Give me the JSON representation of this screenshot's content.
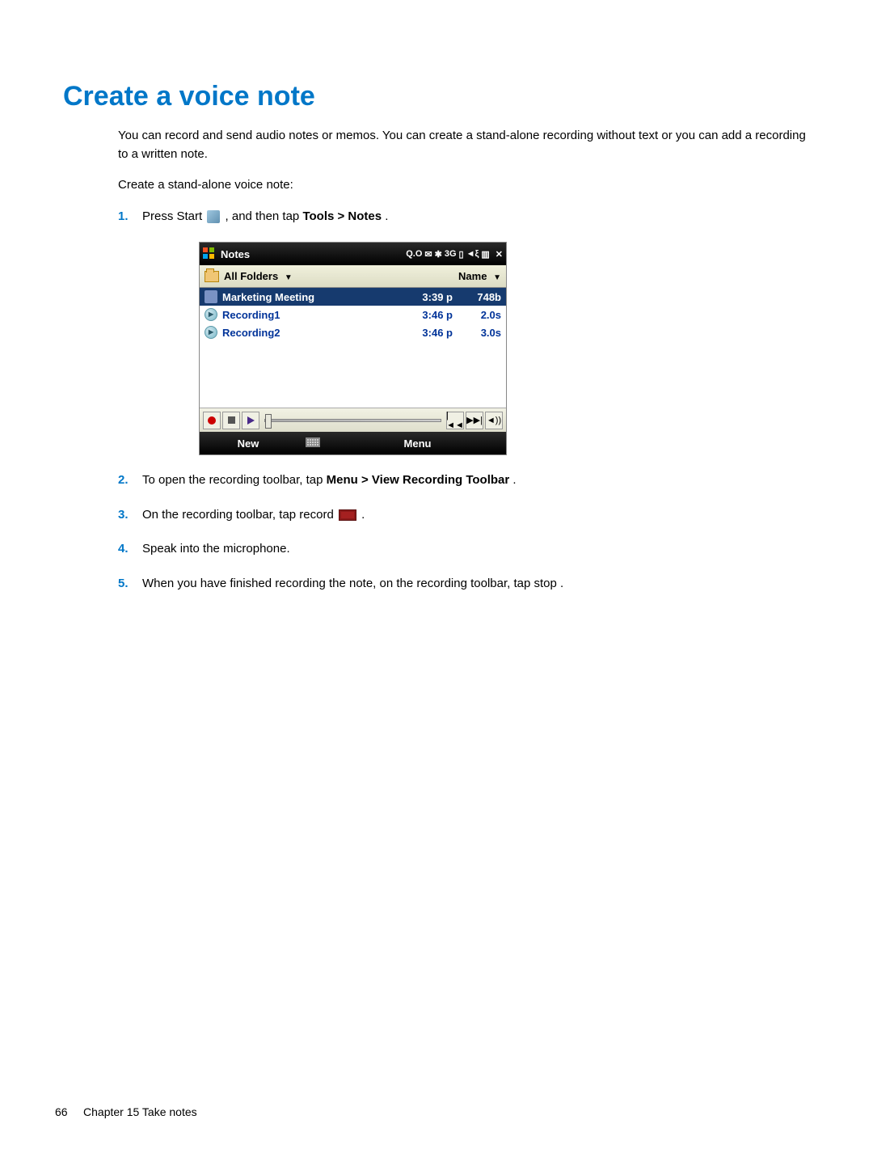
{
  "heading": "Create a voice note",
  "intro": "You can record and send audio notes or memos. You can create a stand-alone recording without text or you can add a recording to a written note.",
  "subintro": "Create a stand-alone voice note:",
  "steps": {
    "s1_a": "Press Start ",
    "s1_b": ", and then tap ",
    "s1_bold": "Tools > Notes",
    "s1_c": ".",
    "s2_a": "To open the recording toolbar, tap ",
    "s2_bold": "Menu > View Recording Toolbar",
    "s2_b": ".",
    "s3_a": "On the recording toolbar, tap record ",
    "s3_b": ".",
    "s4": "Speak into the microphone.",
    "s5_a": "When you have finished recording the note, on the recording toolbar, tap stop ",
    "s5_b": "."
  },
  "step_nums": {
    "n1": "1.",
    "n2": "2.",
    "n3": "3.",
    "n4": "4.",
    "n5": "5."
  },
  "device": {
    "title": "Notes",
    "status": {
      "qo": "Q.O",
      "msg": "✉",
      "bt": "✱",
      "threeg": "3G",
      "sig": "▯",
      "vib": "◄ξ",
      "batt": "▥",
      "close": "✕"
    },
    "header": {
      "folders": "All Folders",
      "sort": "Name"
    },
    "rows": [
      {
        "name": "Marketing Meeting",
        "time": "3:39 p",
        "size": "748b",
        "type": "note",
        "selected": true
      },
      {
        "name": "Recording1",
        "time": "3:46 p",
        "size": "2.0s",
        "type": "audio",
        "selected": false
      },
      {
        "name": "Recording2",
        "time": "3:46 p",
        "size": "3.0s",
        "type": "audio",
        "selected": false
      }
    ],
    "toolbar": {
      "prev": "|◄◄",
      "next": "▶▶|",
      "vol": "◄))"
    },
    "menubar": {
      "new": "New",
      "menu": "Menu"
    }
  },
  "footer": {
    "page": "66",
    "chapter": "Chapter 15   Take notes"
  }
}
